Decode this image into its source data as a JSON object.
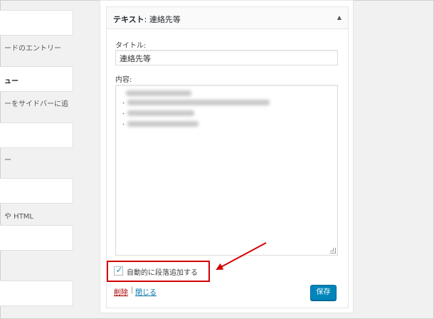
{
  "left": {
    "widgets": [
      {
        "title": "",
        "desc": "ードのエントリー"
      },
      {
        "title": "ュー",
        "desc": "ーをサイドバーに追"
      },
      {
        "title": "",
        "desc": "ー"
      },
      {
        "title": "",
        "desc": "や HTML"
      },
      {
        "title": "",
        "desc": ""
      },
      {
        "title": "",
        "desc": ""
      }
    ]
  },
  "panel": {
    "title_bold": "テキスト",
    "title_rest": ": 連絡先等",
    "toggle_icon": "arrow-up-icon",
    "title_label": "タイトル:",
    "title_value": "連絡先等",
    "content_label": "内容:",
    "content_blurred": true,
    "bullets": [
      "・",
      "・",
      "・"
    ],
    "autop_label": "自動的に段落追加する",
    "autop_checked": true,
    "delete_label": "削除",
    "separator": "|",
    "close_label": "閉じる",
    "save_label": "保存"
  },
  "colors": {
    "primary_button": "#0085ba",
    "highlight": "#d40000",
    "delete_link": "#a00000",
    "link": "#0073aa"
  }
}
